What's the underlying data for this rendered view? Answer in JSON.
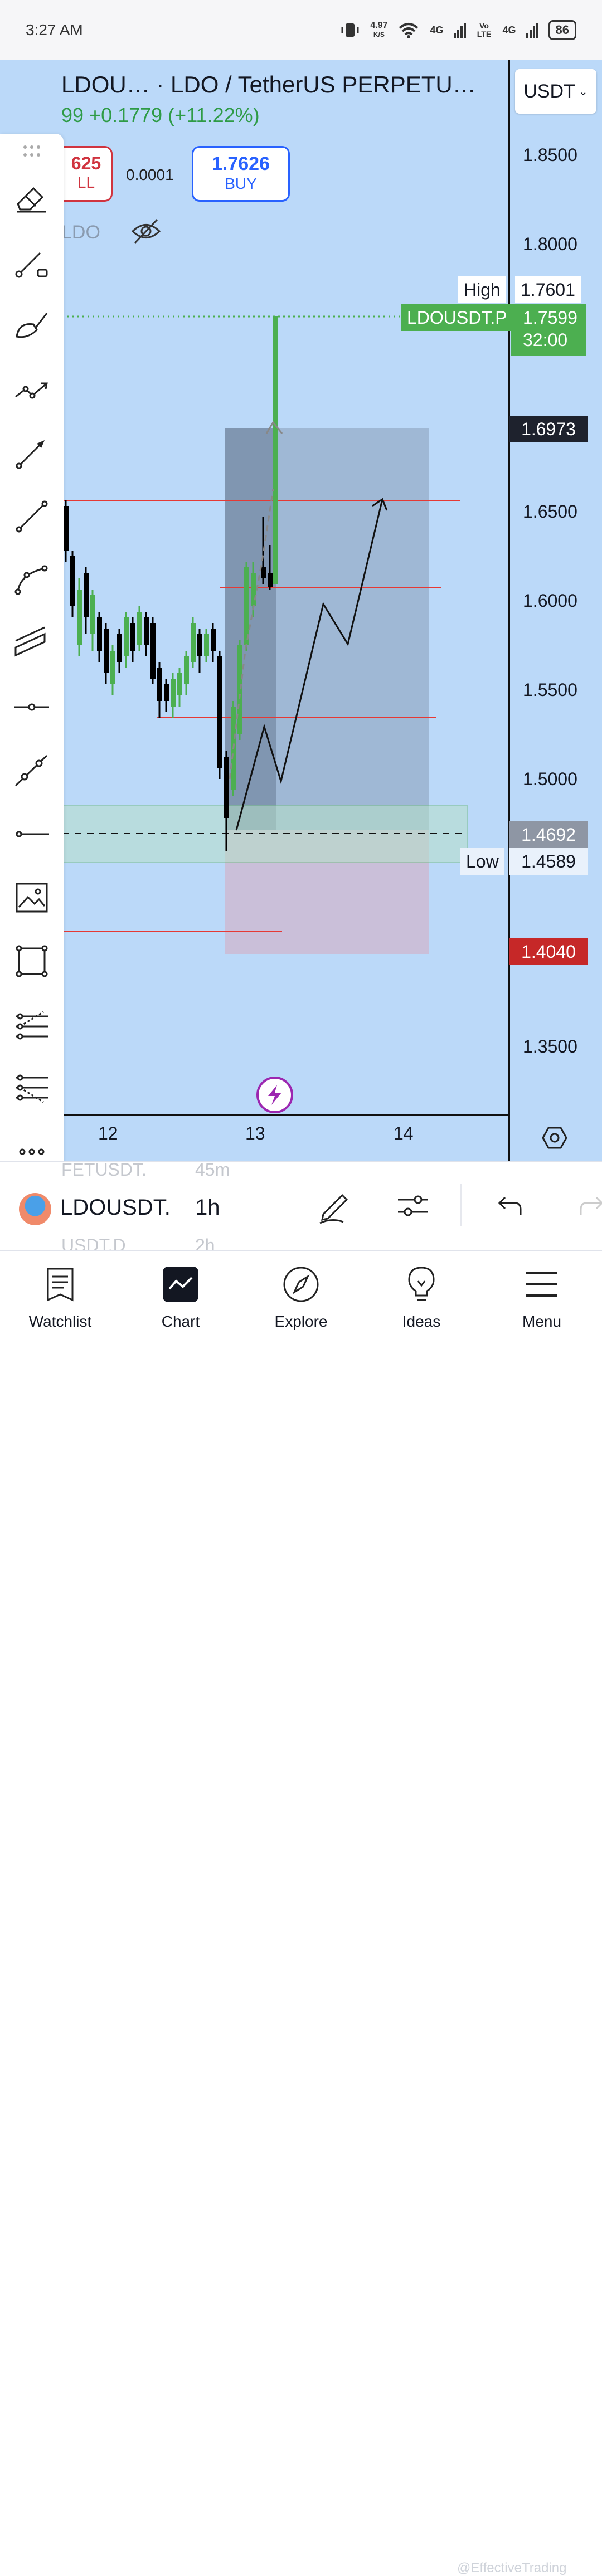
{
  "status_bar": {
    "time": "3:27 AM",
    "net_speed": "4.97",
    "net_unit": "K/S",
    "sig1": "4G",
    "volte": "Vo LTE",
    "sig2": "4G",
    "battery": "86"
  },
  "chart": {
    "title": "LDOU… · LDO / TetherUS PERPETU…",
    "change_line": "99  +0.1779 (+11.22%)",
    "sell_price": "625",
    "sell_label": "LL",
    "spread": "0.0001",
    "buy_price": "1.7626",
    "buy_label": "BUY",
    "indicator_label": "LDO",
    "currency": "USDT",
    "price_ticks": [
      "1.8500",
      "1.8000",
      "1.6500",
      "1.6000",
      "1.5500",
      "1.5000",
      "1.3500"
    ],
    "high_label": "High",
    "high_value": "1.7601",
    "symbol_tag": "LDOUSDT.P",
    "last_price": "1.7599",
    "countdown": "32:00",
    "marker_1": "1.6973",
    "marker_2": "1.4692",
    "low_label": "Low",
    "low_value": "1.4589",
    "stop_price": "1.4040",
    "time_ticks": [
      "12",
      "13",
      "14"
    ],
    "colors": {
      "background": "#bbd9f9",
      "up": "#4caf50",
      "down": "#000000",
      "stop": "#c62828",
      "tag": "#4caf50"
    }
  },
  "symbol_bar": {
    "ghost_above": [
      "FETUSDT.",
      "45m"
    ],
    "symbol": "LDOUSDT.",
    "interval": "1h",
    "ghost_below": [
      "USDT.D",
      "2h"
    ]
  },
  "nav": {
    "items": [
      {
        "label": "Watchlist",
        "icon": "watchlist-icon"
      },
      {
        "label": "Chart",
        "icon": "chart-icon"
      },
      {
        "label": "Explore",
        "icon": "compass-icon"
      },
      {
        "label": "Ideas",
        "icon": "lightbulb-icon"
      },
      {
        "label": "Menu",
        "icon": "hamburger-icon"
      }
    ]
  },
  "watermark": "@EffectiveTrading"
}
